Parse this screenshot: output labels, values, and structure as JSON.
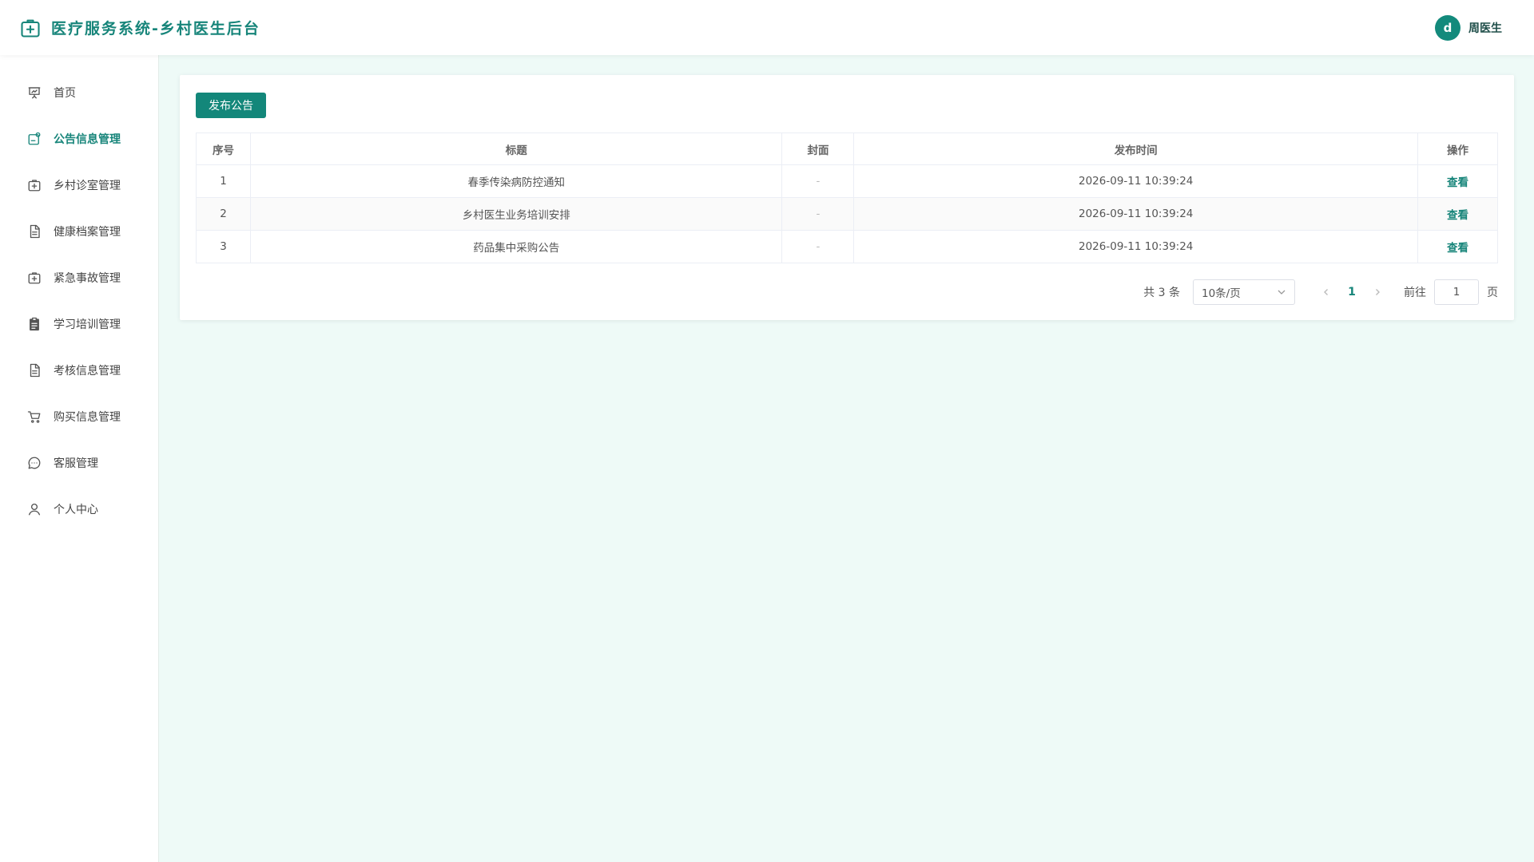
{
  "header": {
    "title": "医疗服务系统-乡村医生后台",
    "avatar_letter": "d",
    "user_name": "周医生",
    "accent": "#17857a"
  },
  "sidebar": {
    "items": [
      {
        "label": "首页",
        "icon": "presentation-chart-icon",
        "active": false
      },
      {
        "label": "公告信息管理",
        "icon": "notice-icon",
        "active": true
      },
      {
        "label": "乡村诊室管理",
        "icon": "medical-kit-icon",
        "active": false
      },
      {
        "label": "健康档案管理",
        "icon": "document-icon",
        "active": false
      },
      {
        "label": "紧急事故管理",
        "icon": "medical-kit-icon",
        "active": false
      },
      {
        "label": "学习培训管理",
        "icon": "clipboard-icon",
        "active": false
      },
      {
        "label": "考核信息管理",
        "icon": "document-icon",
        "active": false
      },
      {
        "label": "购买信息管理",
        "icon": "cart-icon",
        "active": false
      },
      {
        "label": "客服管理",
        "icon": "chat-bubble-icon",
        "active": false
      },
      {
        "label": "个人中心",
        "icon": "user-icon",
        "active": false
      }
    ]
  },
  "main": {
    "publish_label": "发布公告",
    "table": {
      "headers": [
        "序号",
        "标题",
        "封面",
        "发布时间",
        "操作"
      ],
      "rows": [
        {
          "index": "1",
          "title": "春季传染病防控通知",
          "cover": "-",
          "time": "2026-09-11 10:39:24",
          "action": "查看"
        },
        {
          "index": "2",
          "title": "乡村医生业务培训安排",
          "cover": "-",
          "time": "2026-09-11 10:39:24",
          "action": "查看"
        },
        {
          "index": "3",
          "title": "药品集中采购公告",
          "cover": "-",
          "time": "2026-09-11 10:39:24",
          "action": "查看"
        }
      ]
    },
    "pagination": {
      "total": "共 3 条",
      "page_size": "10条/页",
      "current_page": "1",
      "goto_label": "前往",
      "goto_value": "1",
      "page_unit": "页"
    }
  }
}
